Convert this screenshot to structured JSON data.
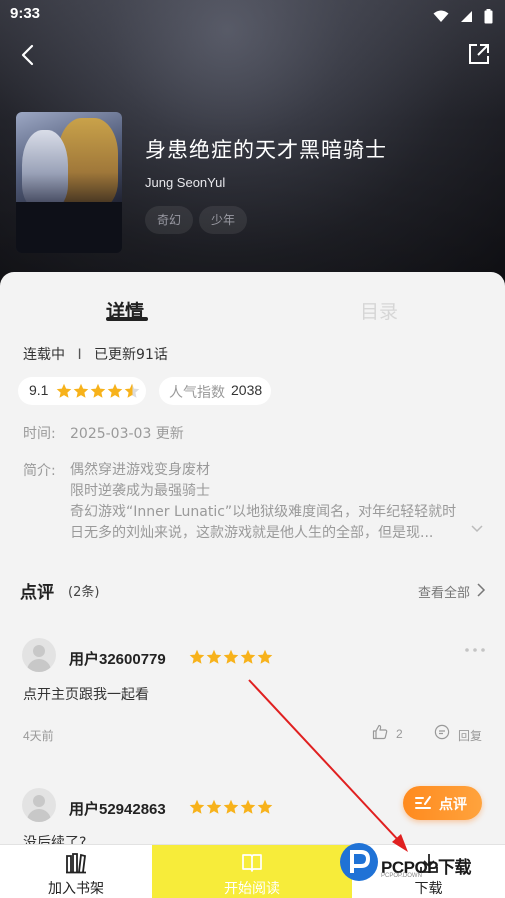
{
  "status_bar": {
    "time": "9:33"
  },
  "header": {
    "back_icon": "chevron-left-icon",
    "share_icon": "share-icon"
  },
  "book": {
    "title": "身患绝症的天才黑暗骑士",
    "author": "Jung SeonYul",
    "tags": [
      "奇幻",
      "少年"
    ]
  },
  "tabs": [
    {
      "label": "详情",
      "active": true
    },
    {
      "label": "目录",
      "active": false
    }
  ],
  "detail": {
    "status": "连载中",
    "separator": "I",
    "updated": "已更新91话",
    "rating": "9.1",
    "rating_stars": 4.5,
    "popularity_label": "人气指数",
    "popularity_value": "2038",
    "time_label": "时间:",
    "time_value": "2025-03-03 更新",
    "intro_label": "简介:",
    "intro_lines": [
      "偶然穿进游戏变身废材",
      "限时逆袭成为最强骑士",
      "奇幻游戏“Inner Lunatic”以地狱级难度闻名，对年纪轻轻就时",
      "日无多的刘灿来说，这款游戏就是他人生的全部，但是现..."
    ]
  },
  "reviews": {
    "title": "点评",
    "count": "(2条)",
    "see_all": "查看全部",
    "items": [
      {
        "user": "用户32600779",
        "stars": 5,
        "text": "点开主页跟我一起看",
        "date": "4天前",
        "likes": "2",
        "reply": "回复"
      },
      {
        "user": "用户52942863",
        "stars": 5,
        "text": "没后续了?"
      }
    ]
  },
  "comment_button": {
    "label": "点评"
  },
  "bottom_bar": {
    "shelf": "加入书架",
    "read": "开始阅读",
    "download": "下载"
  },
  "watermark": {
    "text": "PCPOP下载",
    "sub": "PCPOP.DOWN"
  },
  "colors": {
    "accent_yellow": "#f7ec3a",
    "star": "#f7b21b",
    "comment_orange": "#ff8a1e",
    "annotation_arrow": "#e02020"
  }
}
